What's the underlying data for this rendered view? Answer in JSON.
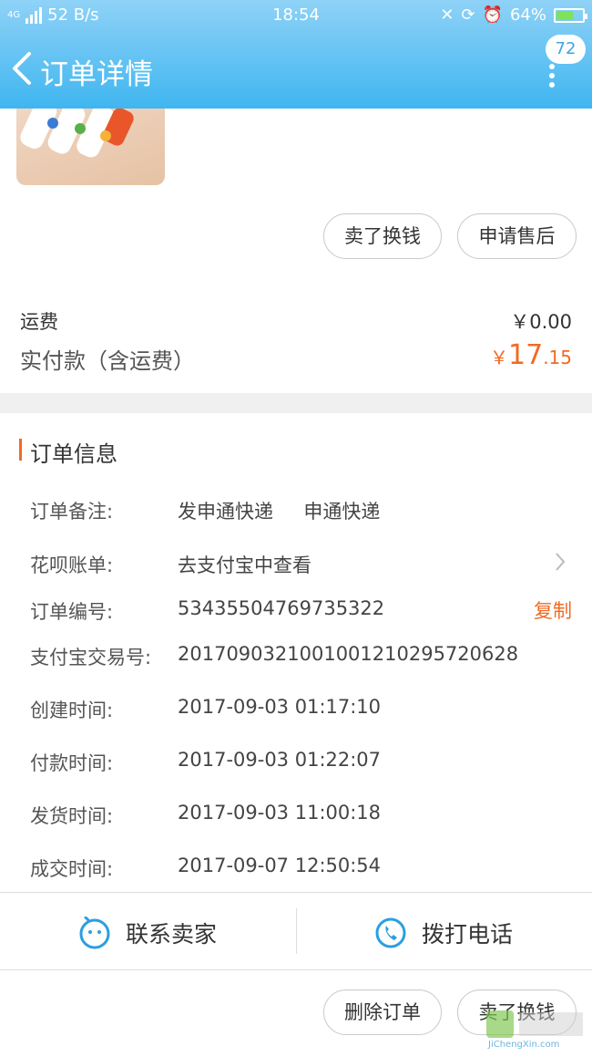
{
  "status_bar": {
    "network": "4G",
    "speed": "52 B/s",
    "time": "18:54",
    "battery": "64%"
  },
  "header": {
    "title": "订单详情",
    "badge_count": "72"
  },
  "buttons_top": {
    "sell": "卖了换钱",
    "after_sale": "申请售后"
  },
  "summary": {
    "shipping_label": "运费",
    "shipping_value": "￥0.00",
    "paid_label": "实付款（含运费）",
    "paid_currency": "￥",
    "paid_int": "17",
    "paid_dec": ".15",
    "accent_color": "#f26a22"
  },
  "order_info": {
    "title": "订单信息",
    "rows": [
      {
        "label": "订单备注:",
        "value": "发申通快递     申通快递"
      },
      {
        "label": "花呗账单:",
        "value": "去支付宝中查看"
      },
      {
        "label": "订单编号:",
        "value": "53435504769735322"
      },
      {
        "label": "支付宝交易号:",
        "value": "2017090321001001210295720628"
      },
      {
        "label": "创建时间:",
        "value": "2017-09-03 01:17:10"
      },
      {
        "label": "付款时间:",
        "value": "2017-09-03 01:22:07"
      },
      {
        "label": "发货时间:",
        "value": "2017-09-03 11:00:18"
      },
      {
        "label": "成交时间:",
        "value": "2017-09-07 12:50:54"
      }
    ],
    "copy_label": "复制"
  },
  "actions": {
    "contact_seller": "联系卖家",
    "call": "拨打电话",
    "icon_color": "#2b9fe0"
  },
  "buttons_bottom": {
    "delete_order": "删除订单",
    "sell": "卖了换钱"
  },
  "watermark": {
    "text": "JiChengXin.com"
  }
}
